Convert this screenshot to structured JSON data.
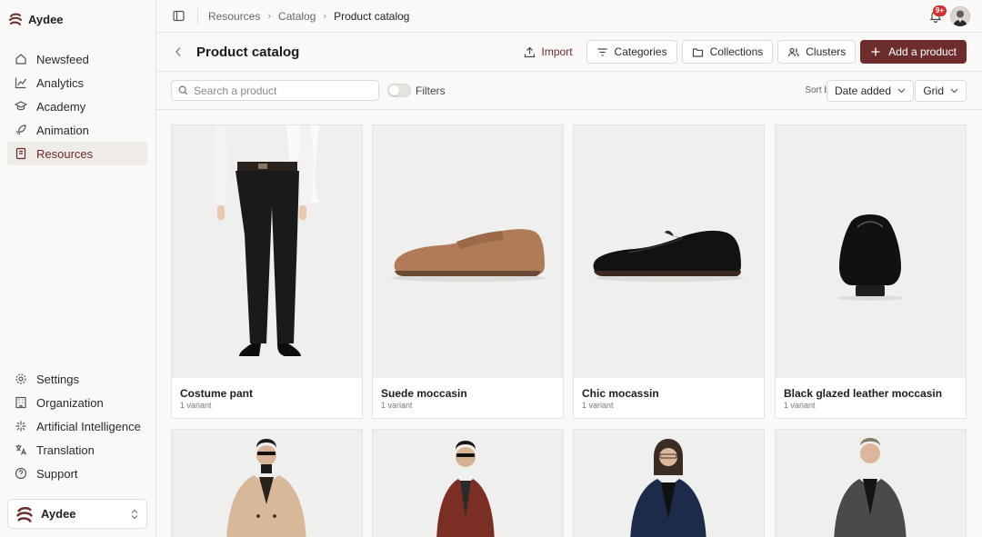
{
  "app": {
    "name": "Aydee",
    "brand_color": "#6e2d2d"
  },
  "sidebar": {
    "top_items": [
      {
        "label": "Newsfeed",
        "icon": "home-icon",
        "active": false
      },
      {
        "label": "Analytics",
        "icon": "chart-line-icon",
        "active": false
      },
      {
        "label": "Academy",
        "icon": "graduation-cap-icon",
        "active": false
      },
      {
        "label": "Animation",
        "icon": "rocket-icon",
        "active": false
      },
      {
        "label": "Resources",
        "icon": "book-icon",
        "active": true
      }
    ],
    "bottom_items": [
      {
        "label": "Settings",
        "icon": "gear-icon"
      },
      {
        "label": "Organization",
        "icon": "building-icon"
      },
      {
        "label": "Artificial Intelligence",
        "icon": "sparkles-icon"
      },
      {
        "label": "Translation",
        "icon": "translate-icon"
      },
      {
        "label": "Support",
        "icon": "help-circle-icon"
      }
    ],
    "org_switcher": {
      "label": "Aydee"
    }
  },
  "topbar": {
    "breadcrumb": [
      "Resources",
      "Catalog",
      "Product catalog"
    ],
    "notifications_badge": "9+"
  },
  "header": {
    "title": "Product catalog",
    "import_label": "Import",
    "categories_label": "Categories",
    "collections_label": "Collections",
    "clusters_label": "Clusters",
    "add_label": "Add a product"
  },
  "filters": {
    "search_placeholder": "Search a product",
    "filters_label": "Filters",
    "filters_on": false,
    "sort_by_label": "Sort by",
    "sort_value": "Date added",
    "view_value": "Grid"
  },
  "products": [
    {
      "name": "Costume pant",
      "variants": "1 variant",
      "image": "trousers"
    },
    {
      "name": "Suede moccasin",
      "variants": "1 variant",
      "image": "brown-loafer"
    },
    {
      "name": "Chic mocassin",
      "variants": "1 variant",
      "image": "black-loafer"
    },
    {
      "name": "Black glazed leather moccasin",
      "variants": "1 variant",
      "image": "black-loafer-front"
    },
    {
      "name": "",
      "variants": "",
      "image": "beige-coat"
    },
    {
      "name": "",
      "variants": "",
      "image": "rust-coat"
    },
    {
      "name": "",
      "variants": "",
      "image": "navy-coat"
    },
    {
      "name": "",
      "variants": "",
      "image": "grey-coat"
    }
  ]
}
